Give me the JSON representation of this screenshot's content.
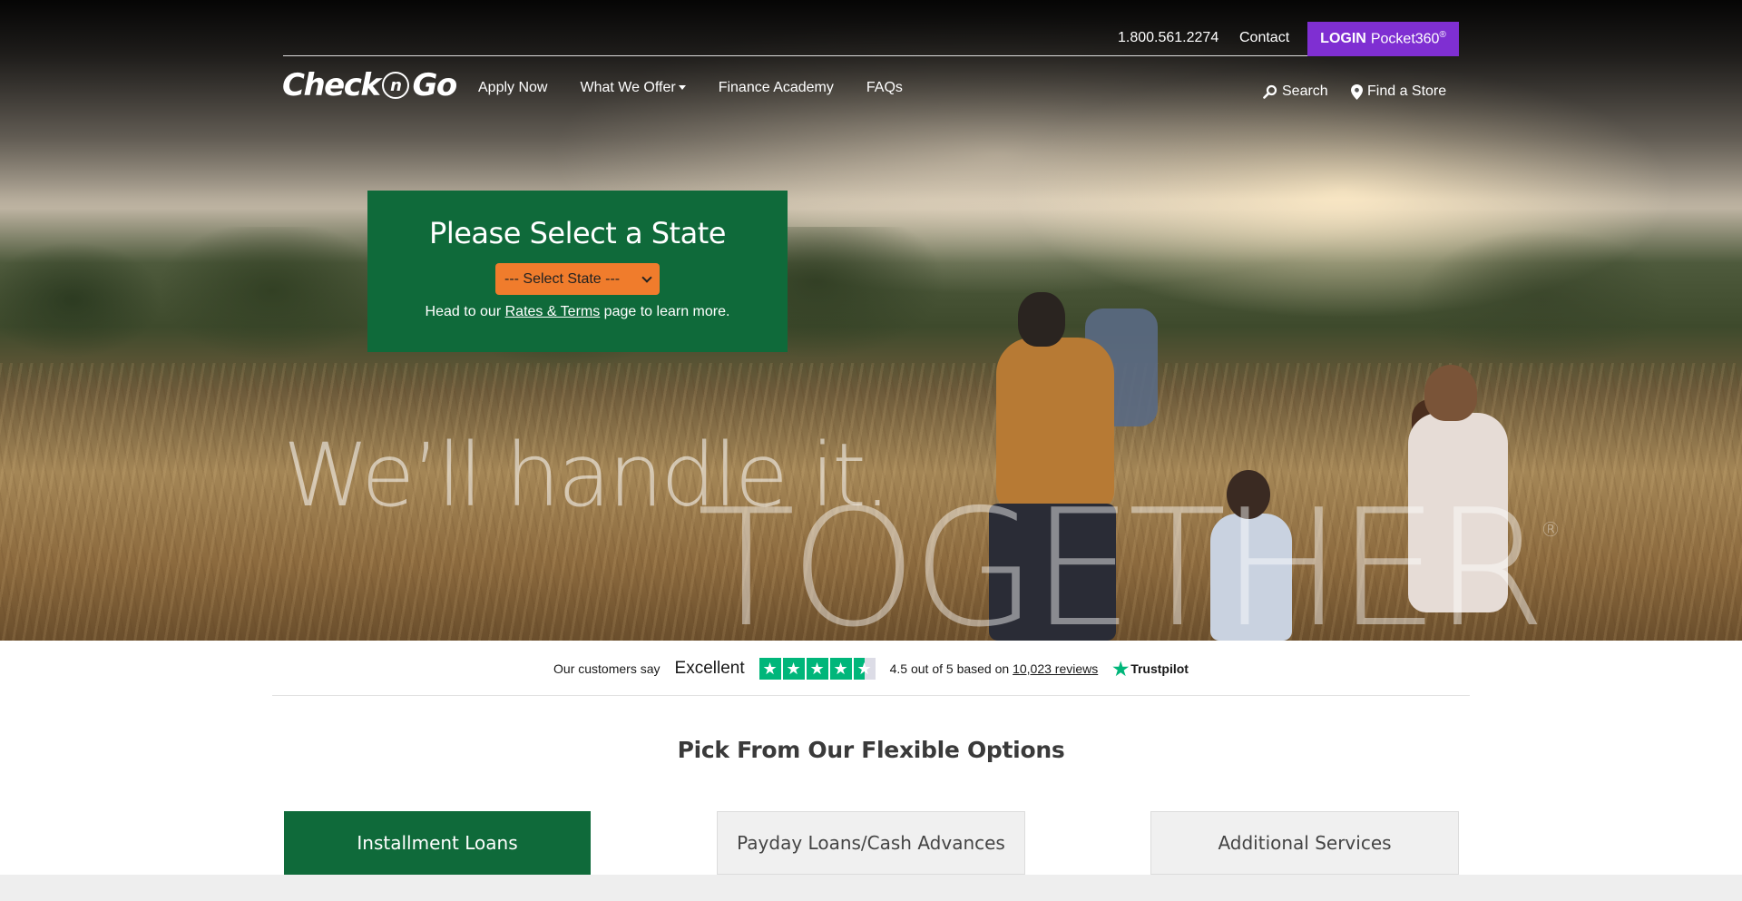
{
  "header": {
    "phone": "1.800.561.2274",
    "contact_label": "Contact",
    "login_label": "LOGIN",
    "login_product": "Pocket360",
    "login_product_mark": "®",
    "logo": {
      "part1": "Check",
      "part2": "n",
      "part3": "Go"
    },
    "nav": [
      {
        "label": "Apply Now"
      },
      {
        "label": "What We Offer",
        "has_dropdown": true
      },
      {
        "label": "Finance Academy"
      },
      {
        "label": "FAQs"
      }
    ],
    "search_label": "Search",
    "find_store_label": "Find a Store"
  },
  "state_box": {
    "title": "Please Select a State",
    "select_value": "--- Select State ---",
    "note_prefix": "Head to our ",
    "note_link": "Rates & Terms",
    "note_suffix": " page to learn more."
  },
  "hero": {
    "tagline": "We’ll handle it.",
    "together": "TOGETHER",
    "together_mark": "®"
  },
  "trustpilot": {
    "customers_say": "Our customers say",
    "rating_word": "Excellent",
    "stars": 4.5,
    "rating_prefix": "4.5 out of 5 based on ",
    "reviews_link": "10,023 reviews",
    "brand": "Trustpilot"
  },
  "options": {
    "title": "Pick From Our Flexible Options",
    "tabs": [
      {
        "label": "Installment Loans",
        "active": true
      },
      {
        "label": "Payday Loans/Cash Advances",
        "active": false
      },
      {
        "label": "Additional Services",
        "active": false
      }
    ]
  },
  "colors": {
    "brand_green": "#0f6a3a",
    "login_purple": "#7f2fd2",
    "select_orange": "#f07c2c",
    "trustpilot_green": "#00b67a"
  }
}
